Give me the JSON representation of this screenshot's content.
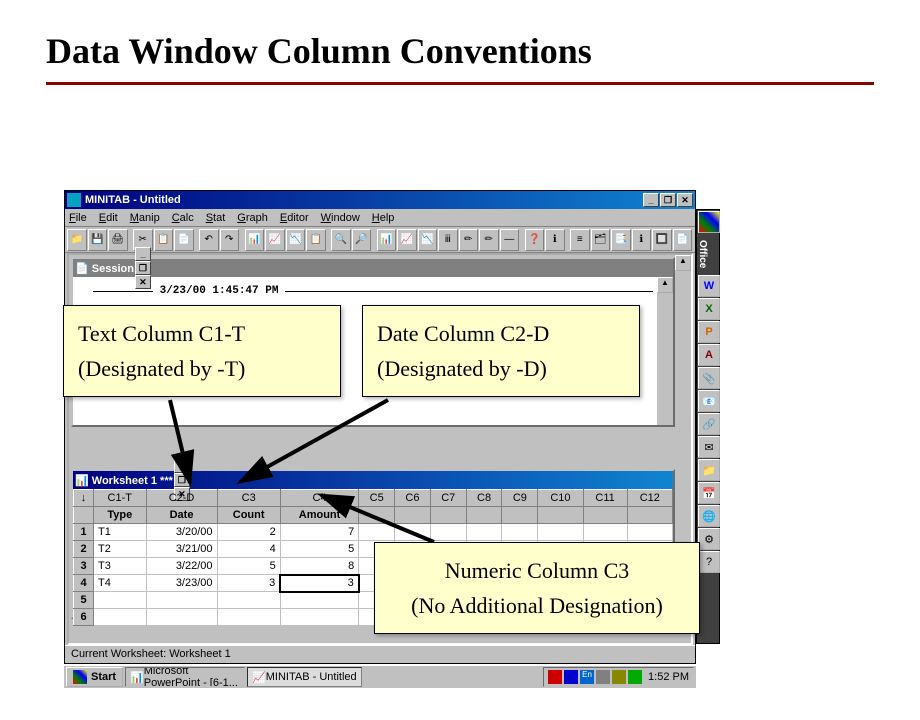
{
  "slide_title": "Data Window Column Conventions",
  "app": {
    "title": "MINITAB - Untitled",
    "menus": [
      "File",
      "Edit",
      "Manip",
      "Calc",
      "Stat",
      "Graph",
      "Editor",
      "Window",
      "Help"
    ],
    "session": {
      "title": "Session",
      "timestamp": "3/23/00 1:45:47 PM"
    },
    "worksheet": {
      "title": "Worksheet 1 ***",
      "col_ids": [
        "C1-T",
        "C2-D",
        "C3",
        "C4",
        "C5",
        "C6",
        "C7",
        "C8",
        "C9",
        "C10",
        "C11",
        "C12"
      ],
      "col_names": [
        "Type",
        "Date",
        "Count",
        "Amount",
        "",
        "",
        "",
        "",
        "",
        "",
        "",
        ""
      ],
      "rows": [
        {
          "n": "1",
          "c": [
            "T1",
            "3/20/00",
            "2",
            "7",
            "",
            "",
            "",
            "",
            "",
            "",
            "",
            ""
          ]
        },
        {
          "n": "2",
          "c": [
            "T2",
            "3/21/00",
            "4",
            "5",
            "",
            "",
            "",
            "",
            "",
            "",
            "",
            ""
          ]
        },
        {
          "n": "3",
          "c": [
            "T3",
            "3/22/00",
            "5",
            "8",
            "",
            "",
            "",
            "",
            "",
            "",
            "",
            ""
          ]
        },
        {
          "n": "4",
          "c": [
            "T4",
            "3/23/00",
            "3",
            "3",
            "",
            "",
            "",
            "",
            "",
            "",
            "",
            ""
          ]
        },
        {
          "n": "5",
          "c": [
            "",
            "",
            "",
            "",
            "",
            "",
            "",
            "",
            "",
            "",
            "",
            ""
          ]
        },
        {
          "n": "6",
          "c": [
            "",
            "",
            "",
            "",
            "",
            "",
            "",
            "",
            "",
            "",
            "",
            ""
          ]
        }
      ]
    },
    "status": "Current Worksheet: Worksheet 1"
  },
  "office_label": "Office",
  "taskbar": {
    "start": "Start",
    "tasks": [
      "Microsoft PowerPoint - [6-1...",
      "MINITAB - Untitled"
    ],
    "clock": "1:52 PM"
  },
  "callouts": {
    "text_col": {
      "line1": "Text Column C1-T",
      "line2": "(Designated by -T)"
    },
    "date_col": {
      "line1": "Date Column C2-D",
      "line2": "(Designated by -D)"
    },
    "num_col": {
      "line1": "Numeric Column C3",
      "line2": "(No Additional Designation)"
    }
  }
}
